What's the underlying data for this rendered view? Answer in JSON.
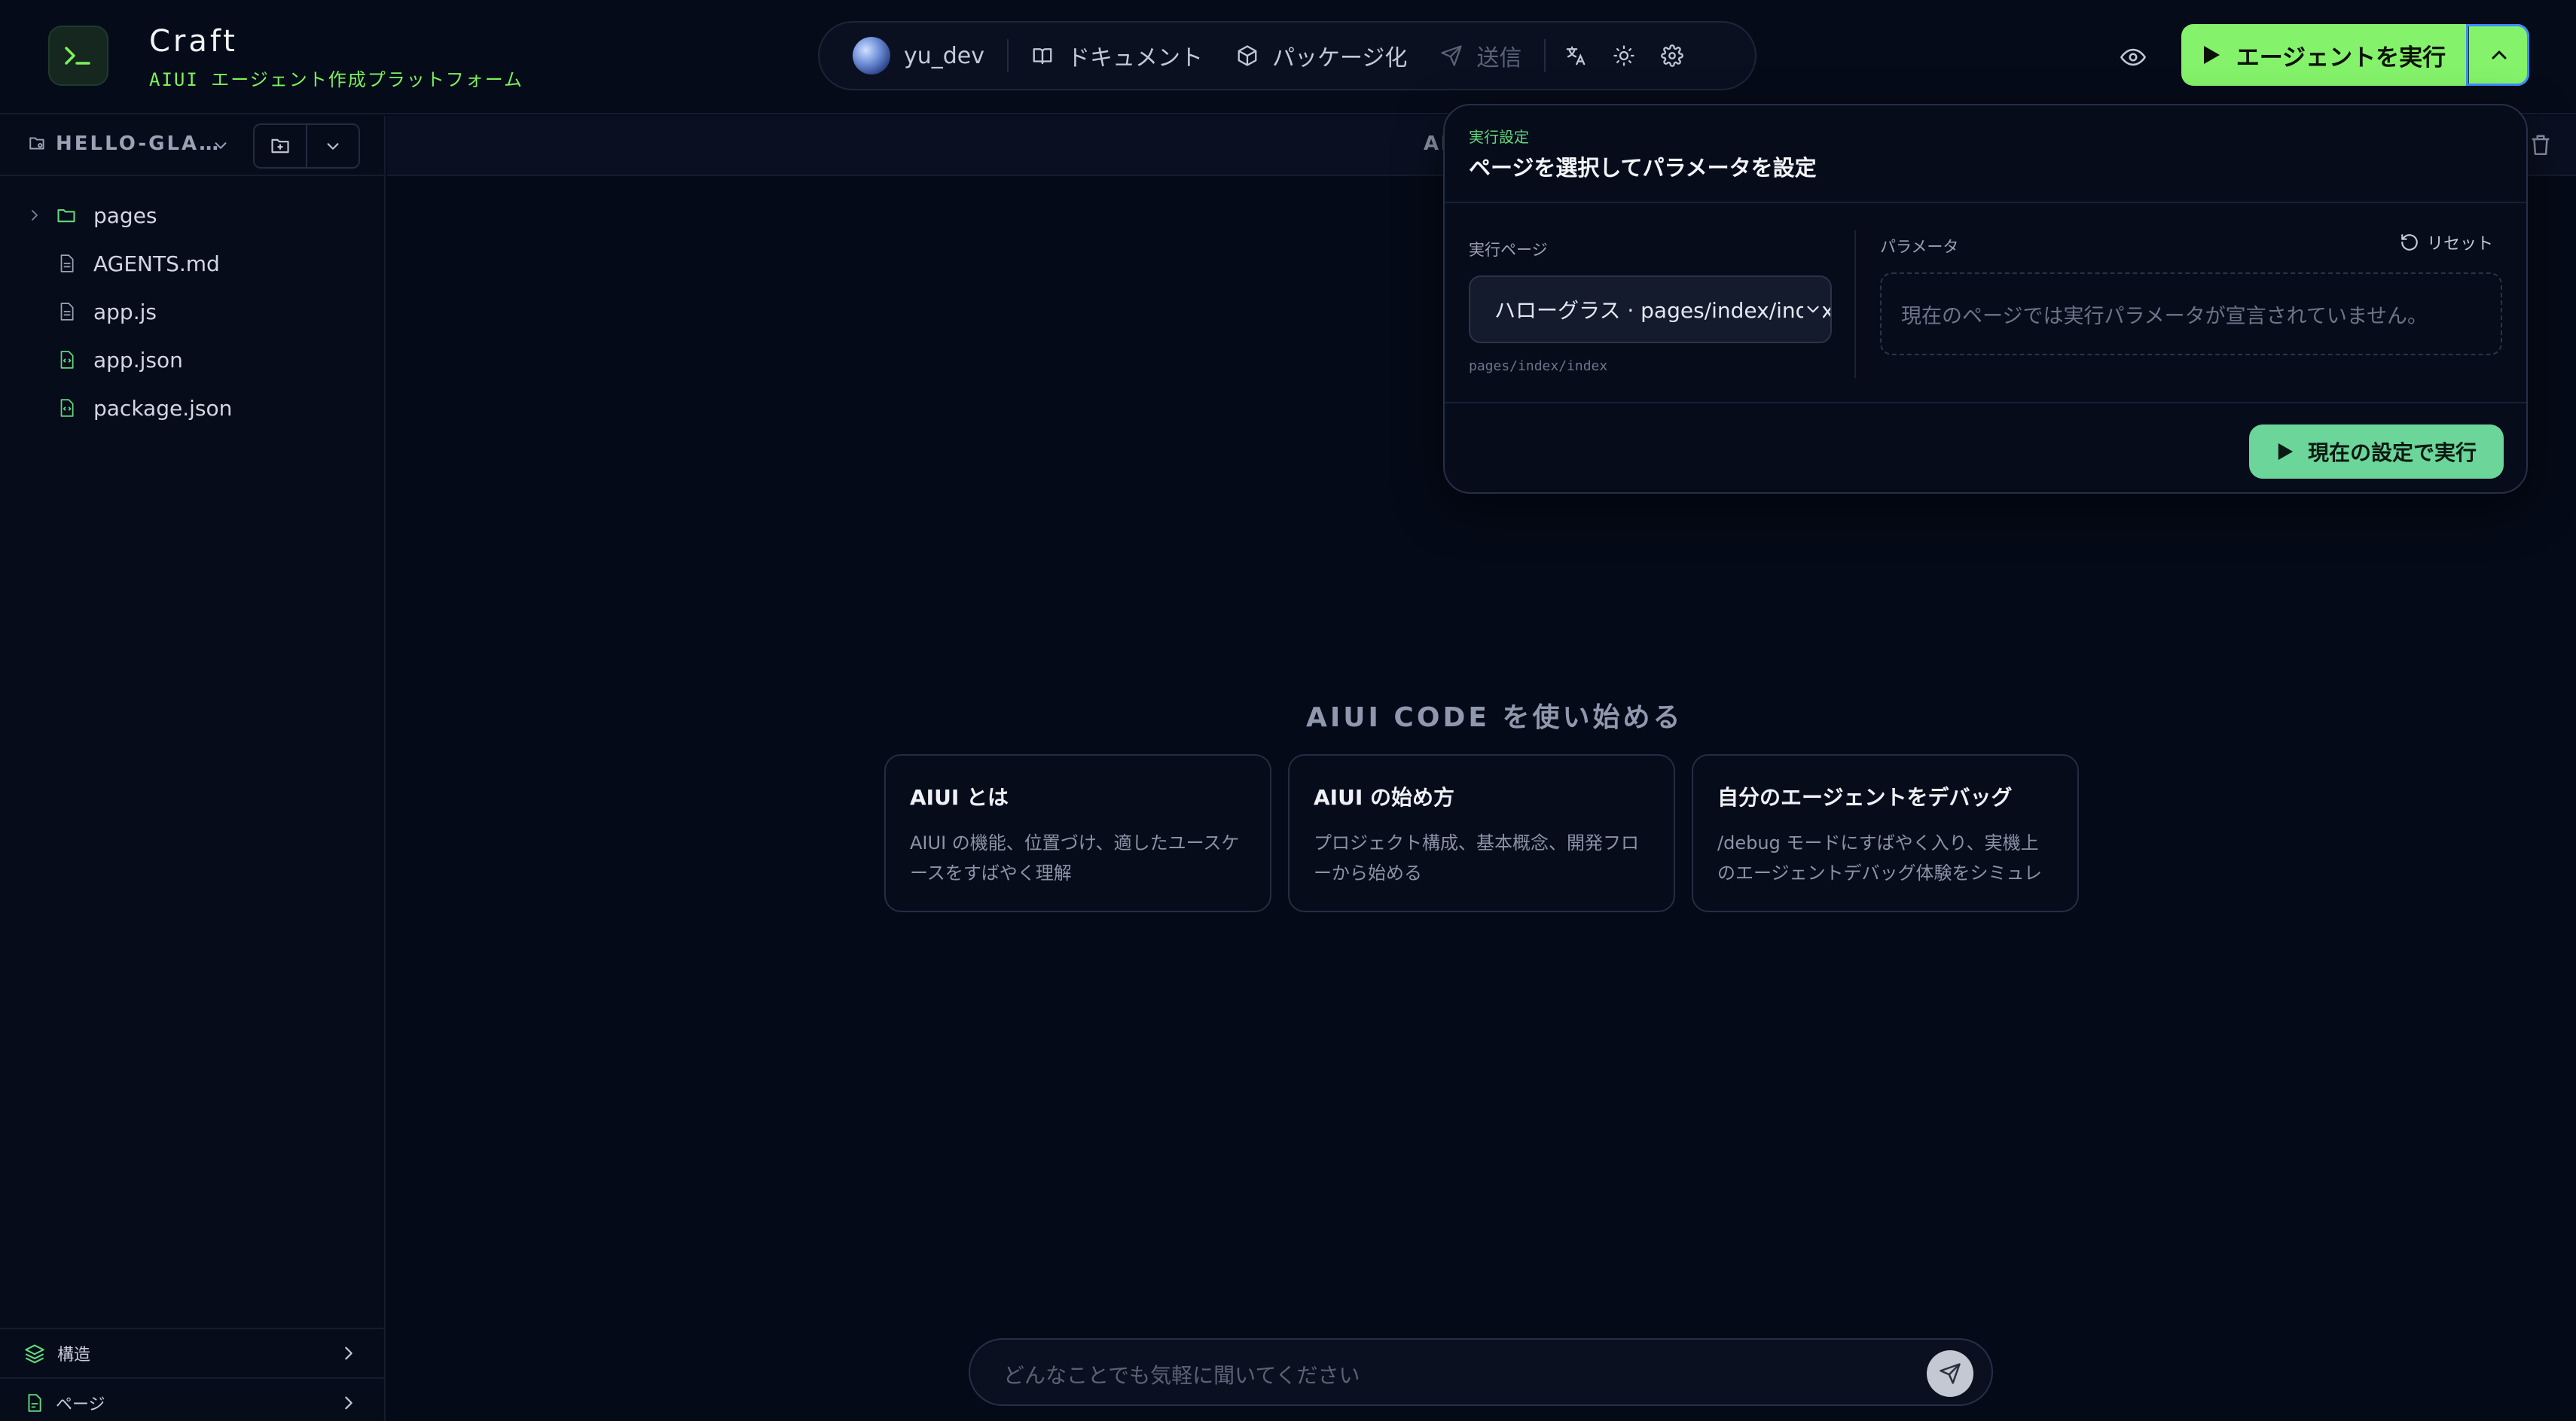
{
  "header": {
    "app_title": "Craft",
    "app_subtitle": "AIUI エージェント作成プラットフォーム",
    "user_name": "yu_dev",
    "nav": {
      "docs": "ドキュメント",
      "package": "パッケージ化",
      "submit": "送信"
    },
    "run_button": "エージェントを実行"
  },
  "sidebar": {
    "project_name": "HELLO-GLA…",
    "tree": [
      {
        "name": "pages",
        "type": "folder"
      },
      {
        "name": "AGENTS.md",
        "type": "file"
      },
      {
        "name": "app.js",
        "type": "file"
      },
      {
        "name": "app.json",
        "type": "json"
      },
      {
        "name": "package.json",
        "type": "json"
      }
    ],
    "bottom": {
      "structure": "構造",
      "pages": "ページ"
    }
  },
  "main": {
    "top_label": "AI",
    "getting_started": "AIUI CODE を使い始める",
    "cards": [
      {
        "title": "AIUI とは",
        "desc": "AIUI の機能、位置づけ、適したユースケースをすばやく理解"
      },
      {
        "title": "AIUI の始め方",
        "desc": "プロジェクト構成、基本概念、開発フローから始める"
      },
      {
        "title": "自分のエージェントをデバッグ",
        "desc": "/debug モードにすばやく入り、実機上のエージェントデバッグ体験をシミュレ"
      }
    ],
    "chat_placeholder": "どんなことでも気軽に聞いてください"
  },
  "run_popover": {
    "kicker": "実行設定",
    "title": "ページを選択してパラメータを設定",
    "page_label": "実行ページ",
    "page_value": "ハローグラス · pages/index/index",
    "route_hint": "pages/index/index",
    "param_label": "パラメータ",
    "reset": "リセット",
    "param_empty": "現在のページでは実行パラメータが宣言されていません。",
    "apply": "現在の設定で実行"
  },
  "colors": {
    "background": "#050a18",
    "accent_green": "#84f26a",
    "apply_green": "#6cd59a",
    "subtitle_green": "#7cf25a"
  }
}
